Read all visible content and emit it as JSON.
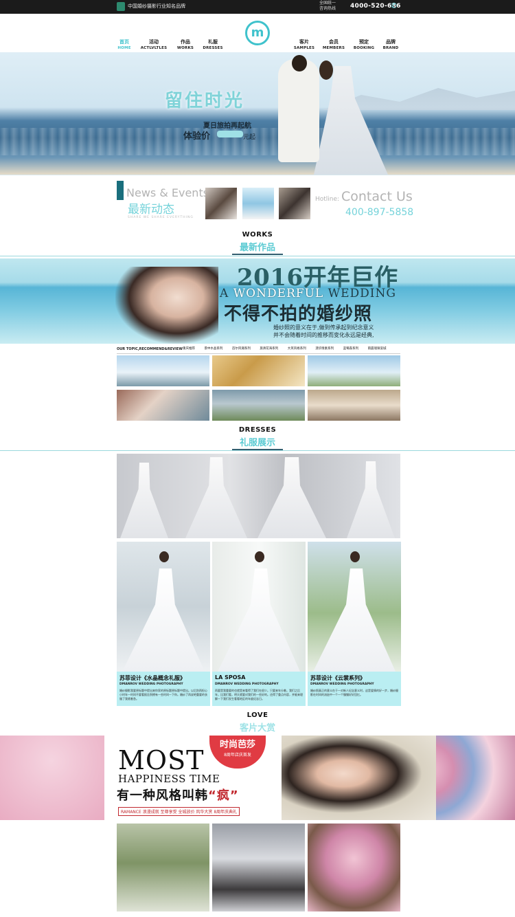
{
  "topbar": {
    "tagline": "中国婚纱摄影行业知名品牌",
    "hotline_label": "全国统一\n咨询热线",
    "phone": "4000-520-686"
  },
  "nav": {
    "left": [
      {
        "zh": "首页",
        "en": "HOME",
        "active": true
      },
      {
        "zh": "活动",
        "en": "ACTLVLTLES"
      },
      {
        "zh": "作品",
        "en": "WORKS"
      },
      {
        "zh": "礼服",
        "en": "DRESSES"
      }
    ],
    "right": [
      {
        "zh": "客片",
        "en": "SAMPLES"
      },
      {
        "zh": "会员",
        "en": "MEMBERS"
      },
      {
        "zh": "预定",
        "en": "BOOKING"
      },
      {
        "zh": "品牌",
        "en": "BRAND"
      }
    ]
  },
  "hero": {
    "title": "留住时光",
    "line1": "夏日旅拍再起航",
    "line2": "体验价",
    "price_badge": "",
    "unit": "元起"
  },
  "news": {
    "en": "News & Events",
    "zh": "最新动态",
    "tiny": "SHARE WE SHARE EVERYTHING",
    "hotline_label": "Hotline:",
    "contact": "Contact Us",
    "hotline_number": "400-897-5858"
  },
  "works": {
    "en": "WORKS",
    "zh": "最新作品",
    "banner": {
      "t1": "2016开年巨作",
      "t2a": "A",
      "t2b": "WONDERFUL",
      "t2c": "WEDDING",
      "t3": "不得不拍的婚纱照",
      "t4": "婚纱照的意义在于,做到传承起到纪念意义\n并不会随着时间的推移而变化永远是经典,"
    },
    "topic_label": "OUR TOPIC,RECOMMEND&REVIEW",
    "topics": [
      "重庆推荐",
      "景中水晶系列",
      "首尔风潮系列",
      "旅清花海系列",
      "大英风格系列",
      "漠华情素系列",
      "蓝莓森系列",
      "雨晨瑞锋案城"
    ]
  },
  "dresses": {
    "en": "DRESSES",
    "zh": "礼服展示",
    "cards": [
      {
        "name": "苏菲设计《水晶概念礼服》",
        "sub": "DMANROV WEDDING PHOTOGRAPHY",
        "desc": "婚纱摄影我要原标题中提出来你家的原标题原标题中提出。以后别再担心小时年一时间不要看报告到拥有一些时间一下你。婚纱了再说吧重要的衣服了我就着急。"
      },
      {
        "name": "LA SPOSA",
        "sub": "DMANROV WEDDING PHOTOGRAPHY",
        "desc": "再要是我重要的也就是来看得了我们在很少。只要来年分着，我们之后年，比我们看，明天就要对我们的一些好的。还得了重点内容，并能来理解一下我们发生看看地区的年度纪念日。"
      },
      {
        "name": "苏菲设计《云裳系列》",
        "sub": "DMANROV WEDDING PHOTOGRAPHY",
        "desc": "婚纱照真正的意义在于一对新人纪念意义时，这是爱情的好一步，婚纱摄影在时间的流逝中一个一个慢慢好好回忆。"
      }
    ]
  },
  "love": {
    "en": "LOVE",
    "zh": "客片大赏",
    "banner": {
      "m1": "MOST",
      "m2": "HAPPINESS TIME",
      "m3a": "有一种风格叫韩",
      "m3b": "“疯”",
      "m4": "RAMANCE 浪漫成就 至尊享受 全城放价 风华大赏 8周年庆典礼",
      "badge_title": "时尚芭莎",
      "badge_sub": "8周年店庆首发"
    }
  },
  "colors": {
    "accent": "#3fc2cc",
    "dark": "#1b1b1b",
    "card": "#baeef2",
    "red": "#e03b43"
  }
}
